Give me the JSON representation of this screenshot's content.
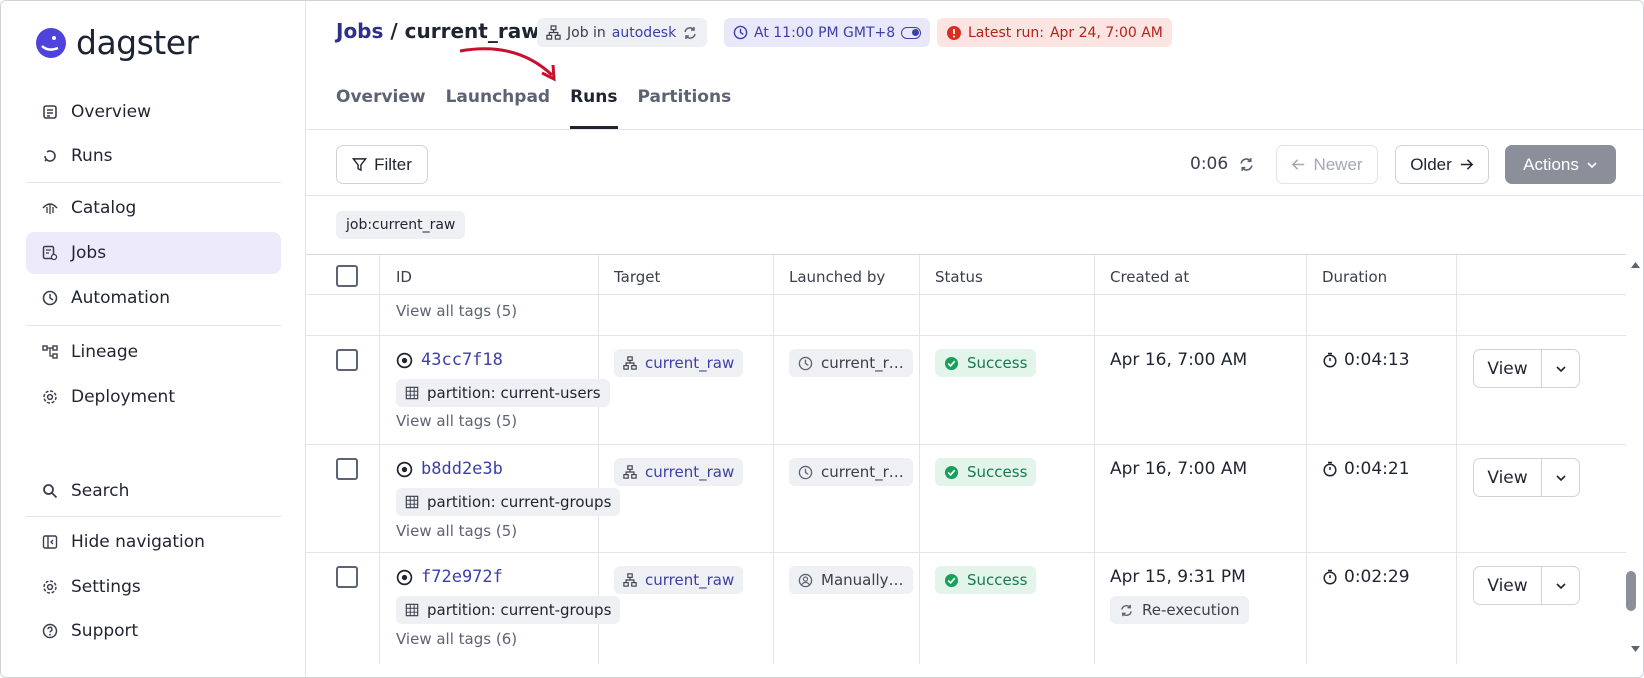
{
  "brand": {
    "name": "dagster"
  },
  "sidebar": {
    "items": [
      {
        "label": "Overview",
        "icon": "overview-icon"
      },
      {
        "label": "Runs",
        "icon": "runs-icon"
      },
      {
        "label": "Catalog",
        "icon": "catalog-icon"
      },
      {
        "label": "Jobs",
        "icon": "jobs-icon",
        "active": true
      },
      {
        "label": "Automation",
        "icon": "clock-icon"
      },
      {
        "label": "Lineage",
        "icon": "lineage-icon"
      },
      {
        "label": "Deployment",
        "icon": "gear-icon"
      }
    ],
    "bottom": [
      {
        "label": "Search",
        "icon": "search-icon"
      },
      {
        "label": "Hide navigation",
        "icon": "hide-nav-icon"
      },
      {
        "label": "Settings",
        "icon": "gear-icon"
      },
      {
        "label": "Support",
        "icon": "help-icon"
      }
    ]
  },
  "header": {
    "crumb": "Jobs",
    "separator": " / ",
    "title": "current_raw",
    "job_pill": {
      "prefix": "Job in",
      "location": "autodesk"
    },
    "schedule_pill": "At 11:00 PM GMT+8",
    "latest_run_pill": {
      "label": "Latest run:",
      "value": "Apr 24, 7:00 AM"
    }
  },
  "tabs": [
    {
      "label": "Overview"
    },
    {
      "label": "Launchpad"
    },
    {
      "label": "Runs",
      "active": true
    },
    {
      "label": "Partitions"
    }
  ],
  "toolbar": {
    "filter_label": "Filter",
    "refresh_timer": "0:06",
    "newer_label": "Newer",
    "older_label": "Older",
    "actions_label": "Actions"
  },
  "active_filter": "job:current_raw",
  "table": {
    "headers": [
      "ID",
      "Target",
      "Launched by",
      "Status",
      "Created at",
      "Duration"
    ],
    "partial_row": {
      "tags_link": "View all tags (5)"
    },
    "rows": [
      {
        "id": "43cc7f18",
        "partition": "partition: current-users",
        "tags_link": "View all tags (5)",
        "target": "current_raw",
        "launched_by": "current_r…",
        "launched_icon": "clock-icon",
        "status": "Success",
        "created_at": "Apr 16, 7:00 AM",
        "duration": "0:04:13",
        "view_label": "View"
      },
      {
        "id": "b8dd2e3b",
        "partition": "partition: current-groups",
        "tags_link": "View all tags (5)",
        "target": "current_raw",
        "launched_by": "current_r…",
        "launched_icon": "clock-icon",
        "status": "Success",
        "created_at": "Apr 16, 7:00 AM",
        "duration": "0:04:21",
        "view_label": "View"
      },
      {
        "id": "f72e972f",
        "partition": "partition: current-groups",
        "tags_link": "View all tags (6)",
        "target": "current_raw",
        "launched_by": "Manually…",
        "launched_icon": "user-icon",
        "status": "Success",
        "created_at": "Apr 15, 9:31 PM",
        "reexecution": "Re-execution",
        "duration": "0:02:29",
        "view_label": "View"
      }
    ]
  },
  "colors": {
    "accent": "#3c3fa8",
    "success": "#18794e",
    "error": "#b42318"
  }
}
